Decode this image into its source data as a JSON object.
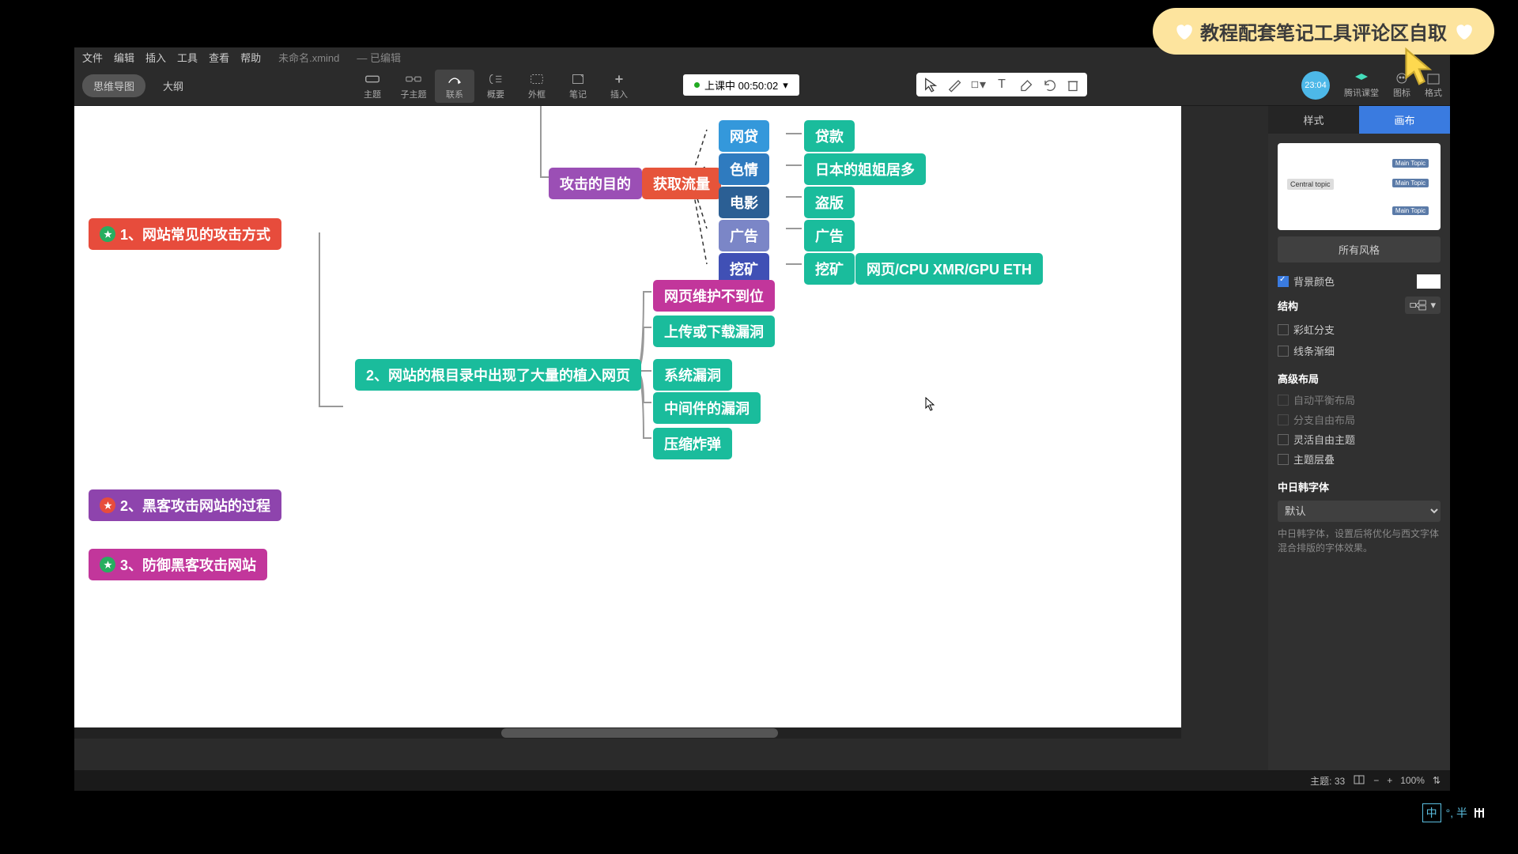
{
  "badge": {
    "text": "教程配套笔记工具评论区自取"
  },
  "menu": {
    "file": "文件",
    "edit": "编辑",
    "insert": "插入",
    "tool": "工具",
    "view": "查看",
    "help": "帮助",
    "filename": "未命名.xmind",
    "state": "— 已编辑"
  },
  "modeTabs": {
    "mindmap": "思维导图",
    "outline": "大纲"
  },
  "tools": {
    "topic": "主题",
    "subtopic": "子主题",
    "relation": "联系",
    "summary": "概要",
    "boundary": "外框",
    "note": "笔记",
    "insert": "插入"
  },
  "status": {
    "text": "上课中 00:50:02"
  },
  "rightTools": {
    "service": "腾讯课堂",
    "icon": "图标",
    "format": "格式"
  },
  "avatar": "23:04",
  "sideTabs": {
    "style": "样式",
    "canvas": "画布"
  },
  "themePreview": {
    "central": "Central topic",
    "main": "Main Topic"
  },
  "allStyles": "所有风格",
  "bgColor": "背景颜色",
  "structure": "结构",
  "rainbow": "彩虹分支",
  "tapered": "线条渐细",
  "advLayout": "高级布局",
  "autoBalance": "自动平衡布局",
  "branchFree": "分支自由布局",
  "flexTopic": "灵活自由主题",
  "topicOverlap": "主题层叠",
  "cjkFont": "中日韩字体",
  "fontDefault": "默认",
  "fontHint": "中日韩字体，设置后将优化与西文字体混合排版的字体效果。",
  "statusbar": {
    "topicCount": "主题: 33",
    "zoom": "100%"
  },
  "nodes": {
    "n1": "1、网站常见的攻击方式",
    "n2": "2、黑客攻击网站的过程",
    "n3": "3、防御黑客攻击网站",
    "purpose": "攻击的目的",
    "traffic": "获取流量",
    "loan": "网贷",
    "loanR": "贷款",
    "porn": "色情",
    "pornR": "日本的姐姐居多",
    "movie": "电影",
    "movieR": "盗版",
    "ad": "广告",
    "adR": "广告",
    "mine": "挖矿",
    "mineR": "挖矿",
    "mineR2": "网页/CPU XMR/GPU  ETH",
    "sec2": "2、网站的根目录中出现了大量的植入网页",
    "c1": "网页维护不到位",
    "c2": "上传或下载漏洞",
    "c3": "系统漏洞",
    "c4": "中间件的漏洞",
    "c5": "压缩炸弹"
  },
  "ime": {
    "zh": "中",
    "sym": "°, 半"
  }
}
